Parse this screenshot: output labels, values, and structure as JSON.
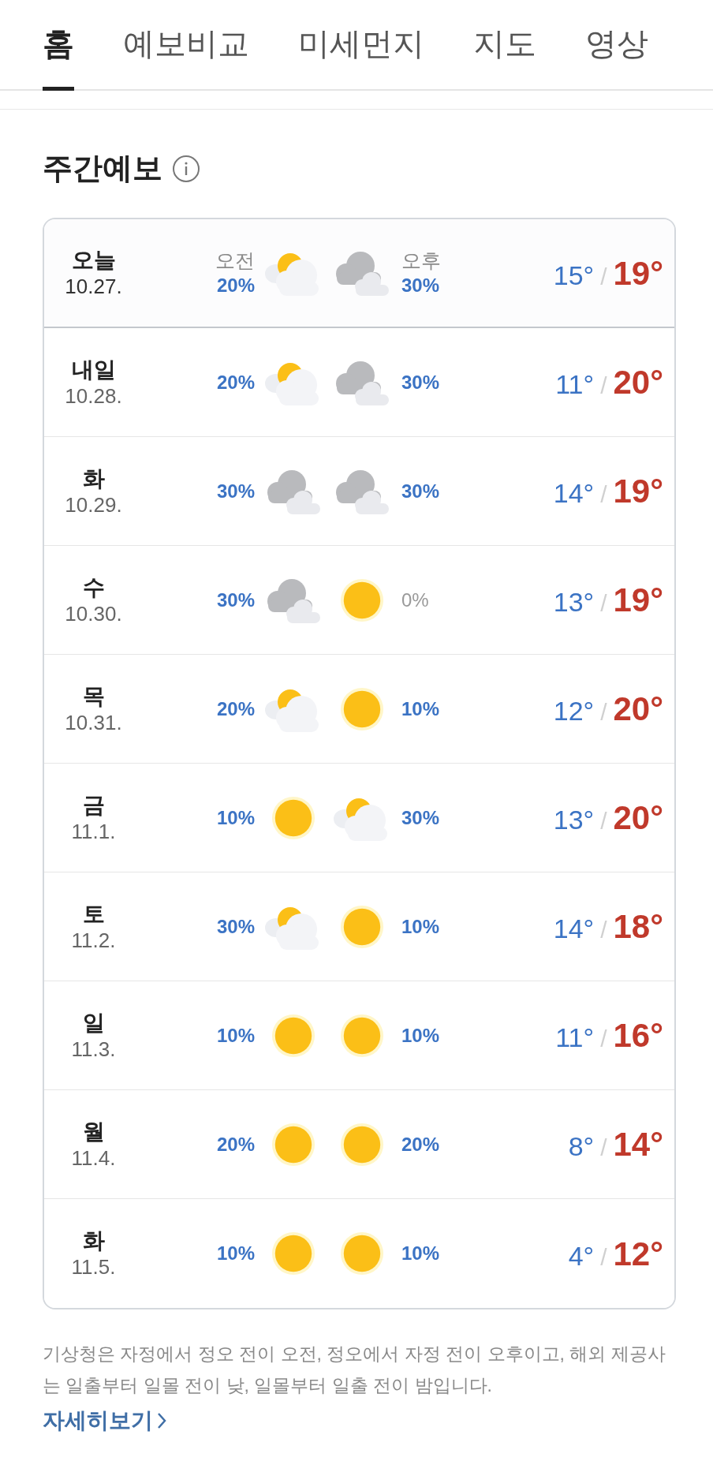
{
  "tabs": [
    {
      "label": "홈",
      "selected": true
    },
    {
      "label": "예보비교",
      "selected": false
    },
    {
      "label": "미세먼지",
      "selected": false
    },
    {
      "label": "지도",
      "selected": false
    },
    {
      "label": "영상",
      "selected": false
    }
  ],
  "section": {
    "title": "주간예보"
  },
  "days": [
    {
      "day": "오늘",
      "date": "10.27.",
      "highlighted": true,
      "am": {
        "label": "오전",
        "precip": "20%",
        "wet": true,
        "kind": "partly_cloudy"
      },
      "pm": {
        "label": "오후",
        "precip": "30%",
        "wet": true,
        "kind": "cloudy"
      },
      "low": "15°",
      "high": "19°"
    },
    {
      "day": "내일",
      "date": "10.28.",
      "highlighted": false,
      "am": {
        "precip": "20%",
        "wet": true,
        "kind": "partly_cloudy"
      },
      "pm": {
        "precip": "30%",
        "wet": true,
        "kind": "cloudy"
      },
      "low": "11°",
      "high": "20°"
    },
    {
      "day": "화",
      "date": "10.29.",
      "highlighted": false,
      "am": {
        "precip": "30%",
        "wet": true,
        "kind": "cloudy"
      },
      "pm": {
        "precip": "30%",
        "wet": true,
        "kind": "cloudy"
      },
      "low": "14°",
      "high": "19°"
    },
    {
      "day": "수",
      "date": "10.30.",
      "highlighted": false,
      "am": {
        "precip": "30%",
        "wet": true,
        "kind": "cloudy"
      },
      "pm": {
        "precip": "0%",
        "wet": false,
        "kind": "sunny"
      },
      "low": "13°",
      "high": "19°"
    },
    {
      "day": "목",
      "date": "10.31.",
      "highlighted": false,
      "am": {
        "precip": "20%",
        "wet": true,
        "kind": "partly_cloudy"
      },
      "pm": {
        "precip": "10%",
        "wet": true,
        "kind": "sunny"
      },
      "low": "12°",
      "high": "20°"
    },
    {
      "day": "금",
      "date": "11.1.",
      "highlighted": false,
      "am": {
        "precip": "10%",
        "wet": true,
        "kind": "sunny"
      },
      "pm": {
        "precip": "30%",
        "wet": true,
        "kind": "partly_cloudy"
      },
      "low": "13°",
      "high": "20°"
    },
    {
      "day": "토",
      "date": "11.2.",
      "highlighted": false,
      "am": {
        "precip": "30%",
        "wet": true,
        "kind": "partly_cloudy"
      },
      "pm": {
        "precip": "10%",
        "wet": true,
        "kind": "sunny"
      },
      "low": "14°",
      "high": "18°"
    },
    {
      "day": "일",
      "date": "11.3.",
      "highlighted": false,
      "am": {
        "precip": "10%",
        "wet": true,
        "kind": "sunny"
      },
      "pm": {
        "precip": "10%",
        "wet": true,
        "kind": "sunny"
      },
      "low": "11°",
      "high": "16°"
    },
    {
      "day": "월",
      "date": "11.4.",
      "highlighted": false,
      "am": {
        "precip": "20%",
        "wet": true,
        "kind": "sunny"
      },
      "pm": {
        "precip": "20%",
        "wet": true,
        "kind": "sunny"
      },
      "low": "8°",
      "high": "14°"
    },
    {
      "day": "화",
      "date": "11.5.",
      "highlighted": false,
      "am": {
        "precip": "10%",
        "wet": true,
        "kind": "sunny"
      },
      "pm": {
        "precip": "10%",
        "wet": true,
        "kind": "sunny"
      },
      "low": "4°",
      "high": "12°"
    }
  ],
  "separator": "/",
  "note": "기상청은 자정에서 정오 전이 오전, 정오에서 자정 전이 오후이고, 해외 제공사는 일출부터 일몰 전이 낮, 일몰부터 일출 전이 밤입니다.",
  "more_link": "자세히보기"
}
